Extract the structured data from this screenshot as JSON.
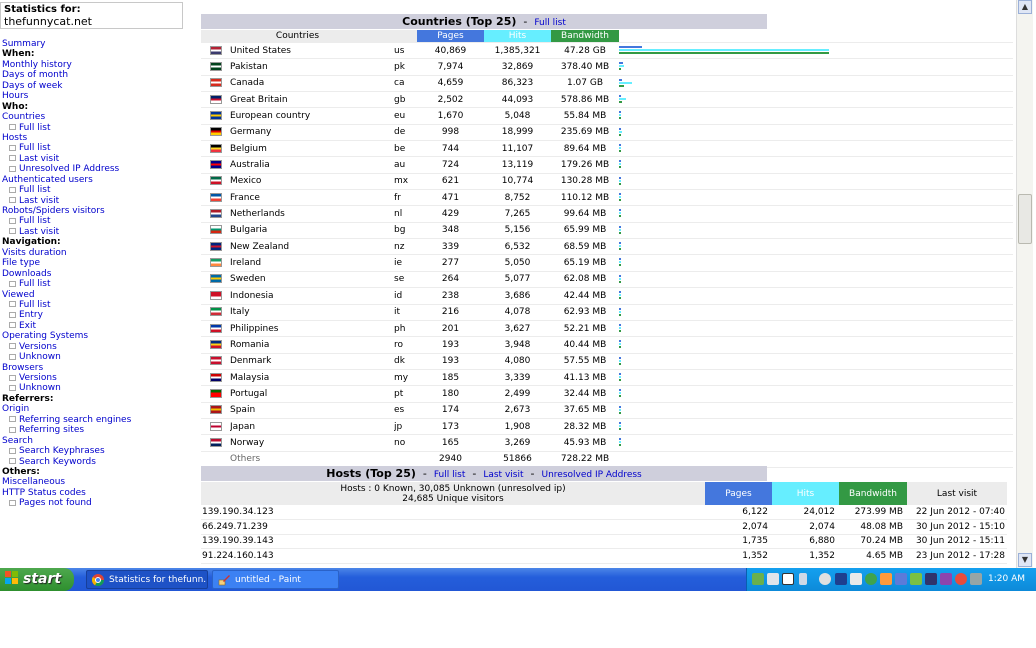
{
  "statbox": {
    "label": "Statistics for:",
    "site": "thefunnycat.net"
  },
  "menu": [
    {
      "text": "Summary",
      "kind": "lnk"
    },
    {
      "text": "When:",
      "kind": "hdr"
    },
    {
      "text": "Monthly history",
      "kind": "lnk"
    },
    {
      "text": "Days of month",
      "kind": "lnk"
    },
    {
      "text": "Days of week",
      "kind": "lnk"
    },
    {
      "text": "Hours",
      "kind": "lnk"
    },
    {
      "text": "Who:",
      "kind": "hdr"
    },
    {
      "text": "Countries",
      "kind": "lnk"
    },
    {
      "text": "Full list",
      "kind": "sub"
    },
    {
      "text": "Hosts",
      "kind": "lnk"
    },
    {
      "text": "Full list",
      "kind": "sub"
    },
    {
      "text": "Last visit",
      "kind": "sub"
    },
    {
      "text": "Unresolved IP Address",
      "kind": "sub"
    },
    {
      "text": "Authenticated users",
      "kind": "lnk"
    },
    {
      "text": "Full list",
      "kind": "sub"
    },
    {
      "text": "Last visit",
      "kind": "sub"
    },
    {
      "text": "Robots/Spiders visitors",
      "kind": "lnk"
    },
    {
      "text": "Full list",
      "kind": "sub"
    },
    {
      "text": "Last visit",
      "kind": "sub"
    },
    {
      "text": "Navigation:",
      "kind": "hdr"
    },
    {
      "text": "Visits duration",
      "kind": "lnk"
    },
    {
      "text": "File type",
      "kind": "lnk"
    },
    {
      "text": "Downloads",
      "kind": "lnk"
    },
    {
      "text": "Full list",
      "kind": "sub"
    },
    {
      "text": "Viewed",
      "kind": "lnk"
    },
    {
      "text": "Full list",
      "kind": "sub"
    },
    {
      "text": "Entry",
      "kind": "sub"
    },
    {
      "text": "Exit",
      "kind": "sub"
    },
    {
      "text": "Operating Systems",
      "kind": "lnk"
    },
    {
      "text": "Versions",
      "kind": "sub"
    },
    {
      "text": "Unknown",
      "kind": "sub"
    },
    {
      "text": "Browsers",
      "kind": "lnk"
    },
    {
      "text": "Versions",
      "kind": "sub"
    },
    {
      "text": "Unknown",
      "kind": "sub"
    },
    {
      "text": "Referrers:",
      "kind": "hdr"
    },
    {
      "text": "Origin",
      "kind": "lnk"
    },
    {
      "text": "Referring search engines",
      "kind": "sub"
    },
    {
      "text": "Referring sites",
      "kind": "sub"
    },
    {
      "text": "Search",
      "kind": "lnk"
    },
    {
      "text": "Search Keyphrases",
      "kind": "sub"
    },
    {
      "text": "Search Keywords",
      "kind": "sub"
    },
    {
      "text": "Others:",
      "kind": "hdr"
    },
    {
      "text": "Miscellaneous",
      "kind": "lnk"
    },
    {
      "text": "HTTP Status codes",
      "kind": "lnk"
    },
    {
      "text": "Pages not found",
      "kind": "sub"
    }
  ],
  "countries": {
    "title": "Countries (Top 25)",
    "sep": "-",
    "full_list": "Full list",
    "headers": {
      "countries": "Countries",
      "pages": "Pages",
      "hits": "Hits",
      "bandwidth": "Bandwidth"
    },
    "colors": {
      "pages": "#4477dd",
      "hits": "#66eeff",
      "bandwidth": "#339944"
    },
    "rows": [
      {
        "name": "United States",
        "code": "us",
        "pages": "40,869",
        "hits": "1,385,321",
        "bw": "47.28 GB",
        "flag": [
          "#b22234",
          "#ffffff",
          "#3c3b6e"
        ],
        "p": 40869,
        "h": 1385321,
        "b": 47.28
      },
      {
        "name": "Pakistan",
        "code": "pk",
        "pages": "7,974",
        "hits": "32,869",
        "bw": "378.40 MB",
        "flag": [
          "#01411c",
          "#ffffff",
          "#01411c"
        ],
        "p": 7974,
        "h": 32869,
        "b": 0.378
      },
      {
        "name": "Canada",
        "code": "ca",
        "pages": "4,659",
        "hits": "86,323",
        "bw": "1.07 GB",
        "flag": [
          "#d52b1e",
          "#ffffff",
          "#d52b1e"
        ],
        "p": 4659,
        "h": 86323,
        "b": 1.07
      },
      {
        "name": "Great Britain",
        "code": "gb",
        "pages": "2,502",
        "hits": "44,093",
        "bw": "578.86 MB",
        "flag": [
          "#012169",
          "#c8102e",
          "#ffffff"
        ],
        "p": 2502,
        "h": 44093,
        "b": 0.579
      },
      {
        "name": "European country",
        "code": "eu",
        "pages": "1,670",
        "hits": "5,048",
        "bw": "55.84 MB",
        "flag": [
          "#003399",
          "#ffcc00",
          "#003399"
        ],
        "p": 1670,
        "h": 5048,
        "b": 0.056
      },
      {
        "name": "Germany",
        "code": "de",
        "pages": "998",
        "hits": "18,999",
        "bw": "235.69 MB",
        "flag": [
          "#000000",
          "#dd0000",
          "#ffce00"
        ],
        "p": 998,
        "h": 18999,
        "b": 0.236
      },
      {
        "name": "Belgium",
        "code": "be",
        "pages": "744",
        "hits": "11,107",
        "bw": "89.64 MB",
        "flag": [
          "#000000",
          "#fdda24",
          "#ef3340"
        ],
        "p": 744,
        "h": 11107,
        "b": 0.0896
      },
      {
        "name": "Australia",
        "code": "au",
        "pages": "724",
        "hits": "13,119",
        "bw": "179.26 MB",
        "flag": [
          "#00008b",
          "#ff0000",
          "#00008b"
        ],
        "p": 724,
        "h": 13119,
        "b": 0.179
      },
      {
        "name": "Mexico",
        "code": "mx",
        "pages": "621",
        "hits": "10,774",
        "bw": "130.28 MB",
        "flag": [
          "#006847",
          "#ffffff",
          "#ce1126"
        ],
        "p": 621,
        "h": 10774,
        "b": 0.13
      },
      {
        "name": "France",
        "code": "fr",
        "pages": "471",
        "hits": "8,752",
        "bw": "110.12 MB",
        "flag": [
          "#0055a4",
          "#ffffff",
          "#ef4135"
        ],
        "p": 471,
        "h": 8752,
        "b": 0.11
      },
      {
        "name": "Netherlands",
        "code": "nl",
        "pages": "429",
        "hits": "7,265",
        "bw": "99.64 MB",
        "flag": [
          "#ae1c28",
          "#ffffff",
          "#21468b"
        ],
        "p": 429,
        "h": 7265,
        "b": 0.0996
      },
      {
        "name": "Bulgaria",
        "code": "bg",
        "pages": "348",
        "hits": "5,156",
        "bw": "65.99 MB",
        "flag": [
          "#ffffff",
          "#00966e",
          "#d62612"
        ],
        "p": 348,
        "h": 5156,
        "b": 0.066
      },
      {
        "name": "New Zealand",
        "code": "nz",
        "pages": "339",
        "hits": "6,532",
        "bw": "68.59 MB",
        "flag": [
          "#00247d",
          "#cc142b",
          "#00247d"
        ],
        "p": 339,
        "h": 6532,
        "b": 0.0686
      },
      {
        "name": "Ireland",
        "code": "ie",
        "pages": "277",
        "hits": "5,050",
        "bw": "65.19 MB",
        "flag": [
          "#169b62",
          "#ffffff",
          "#ff883e"
        ],
        "p": 277,
        "h": 5050,
        "b": 0.0652
      },
      {
        "name": "Sweden",
        "code": "se",
        "pages": "264",
        "hits": "5,077",
        "bw": "62.08 MB",
        "flag": [
          "#006aa7",
          "#fecc00",
          "#006aa7"
        ],
        "p": 264,
        "h": 5077,
        "b": 0.0621
      },
      {
        "name": "Indonesia",
        "code": "id",
        "pages": "238",
        "hits": "3,686",
        "bw": "42.44 MB",
        "flag": [
          "#ce1126",
          "#ce1126",
          "#ffffff"
        ],
        "p": 238,
        "h": 3686,
        "b": 0.0424
      },
      {
        "name": "Italy",
        "code": "it",
        "pages": "216",
        "hits": "4,078",
        "bw": "62.93 MB",
        "flag": [
          "#009246",
          "#ffffff",
          "#ce2b37"
        ],
        "p": 216,
        "h": 4078,
        "b": 0.0629
      },
      {
        "name": "Philippines",
        "code": "ph",
        "pages": "201",
        "hits": "3,627",
        "bw": "52.21 MB",
        "flag": [
          "#0038a8",
          "#ffffff",
          "#ce1126"
        ],
        "p": 201,
        "h": 3627,
        "b": 0.0522
      },
      {
        "name": "Romania",
        "code": "ro",
        "pages": "193",
        "hits": "3,948",
        "bw": "40.44 MB",
        "flag": [
          "#002b7f",
          "#fcd116",
          "#ce1126"
        ],
        "p": 193,
        "h": 3948,
        "b": 0.0404
      },
      {
        "name": "Denmark",
        "code": "dk",
        "pages": "193",
        "hits": "4,080",
        "bw": "57.55 MB",
        "flag": [
          "#c8102e",
          "#ffffff",
          "#c8102e"
        ],
        "p": 193,
        "h": 4080,
        "b": 0.0576
      },
      {
        "name": "Malaysia",
        "code": "my",
        "pages": "185",
        "hits": "3,339",
        "bw": "41.13 MB",
        "flag": [
          "#cc0001",
          "#ffffff",
          "#010066"
        ],
        "p": 185,
        "h": 3339,
        "b": 0.0411
      },
      {
        "name": "Portugal",
        "code": "pt",
        "pages": "180",
        "hits": "2,499",
        "bw": "32.44 MB",
        "flag": [
          "#006600",
          "#ff0000",
          "#ff0000"
        ],
        "p": 180,
        "h": 2499,
        "b": 0.0324
      },
      {
        "name": "Spain",
        "code": "es",
        "pages": "174",
        "hits": "2,673",
        "bw": "37.65 MB",
        "flag": [
          "#aa151b",
          "#f1bf00",
          "#aa151b"
        ],
        "p": 174,
        "h": 2673,
        "b": 0.0377
      },
      {
        "name": "Japan",
        "code": "jp",
        "pages": "173",
        "hits": "1,908",
        "bw": "28.32 MB",
        "flag": [
          "#ffffff",
          "#bc002d",
          "#ffffff"
        ],
        "p": 173,
        "h": 1908,
        "b": 0.0283
      },
      {
        "name": "Norway",
        "code": "no",
        "pages": "165",
        "hits": "3,269",
        "bw": "45.93 MB",
        "flag": [
          "#ba0c2f",
          "#ffffff",
          "#00205b"
        ],
        "p": 165,
        "h": 3269,
        "b": 0.0459
      }
    ],
    "others": {
      "name": "Others",
      "pages": "2940",
      "hits": "51866",
      "bw": "728.22 MB"
    }
  },
  "hosts": {
    "title": "Hosts (Top 25)",
    "sep": "-",
    "full_list": "Full list",
    "last_visit": "Last visit",
    "unresolved": "Unresolved IP Address",
    "summary1": "Hosts : 0 Known, 30,085 Unknown (unresolved ip)",
    "summary2": "24,685 Unique visitors",
    "headers": {
      "pages": "Pages",
      "hits": "Hits",
      "bandwidth": "Bandwidth",
      "last": "Last visit"
    },
    "rows": [
      {
        "ip": "139.190.34.123",
        "pages": "6,122",
        "hits": "24,012",
        "bw": "273.99 MB",
        "last": "22 Jun 2012 - 07:40"
      },
      {
        "ip": "66.249.71.239",
        "pages": "2,074",
        "hits": "2,074",
        "bw": "48.08 MB",
        "last": "30 Jun 2012 - 15:10"
      },
      {
        "ip": "139.190.39.143",
        "pages": "1,735",
        "hits": "6,880",
        "bw": "70.24 MB",
        "last": "30 Jun 2012 - 15:11"
      },
      {
        "ip": "91.224.160.143",
        "pages": "1,352",
        "hits": "1,352",
        "bw": "4.65 MB",
        "last": "23 Jun 2012 - 17:28"
      }
    ]
  },
  "taskbar": {
    "start": "start",
    "tasks": [
      {
        "label": "Statistics for thefunn...",
        "icon": "chrome-icon"
      },
      {
        "label": "untitled - Paint",
        "icon": "paint-icon"
      }
    ],
    "clock": "1:20 AM"
  },
  "scroll": {
    "up": "▲",
    "down": "▼"
  }
}
